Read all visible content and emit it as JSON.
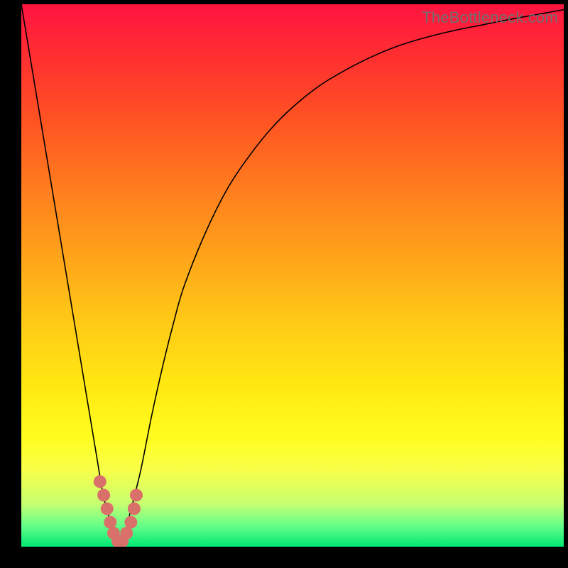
{
  "watermark": "TheBottleneck.com",
  "chart_data": {
    "type": "line",
    "title": "",
    "xlabel": "",
    "ylabel": "",
    "xlim": [
      0,
      100
    ],
    "ylim": [
      0,
      100
    ],
    "x": [
      0,
      2,
      4,
      6,
      8,
      10,
      12,
      13,
      14,
      15,
      16,
      17,
      18,
      19,
      20,
      22,
      24,
      26,
      28,
      30,
      34,
      38,
      42,
      46,
      50,
      55,
      60,
      65,
      70,
      75,
      80,
      85,
      90,
      95,
      100
    ],
    "values": [
      100,
      88,
      76,
      64,
      52,
      40,
      28,
      22,
      16,
      10,
      6,
      2,
      0,
      2,
      6,
      14,
      24,
      33,
      41,
      48,
      58,
      66,
      72,
      77,
      81,
      85,
      88,
      90.5,
      92.5,
      94,
      95.2,
      96.2,
      97.2,
      98.1,
      99
    ],
    "markers": {
      "x": [
        14.5,
        15.2,
        15.8,
        16.4,
        17.0,
        17.8,
        18.6,
        19.4,
        20.2,
        20.8,
        21.2
      ],
      "y": [
        12,
        9.5,
        7,
        4.5,
        2.5,
        1,
        1,
        2.5,
        4.5,
        7,
        9.5
      ]
    },
    "marker_color": "#d9716a",
    "curve_color": "#000000"
  }
}
